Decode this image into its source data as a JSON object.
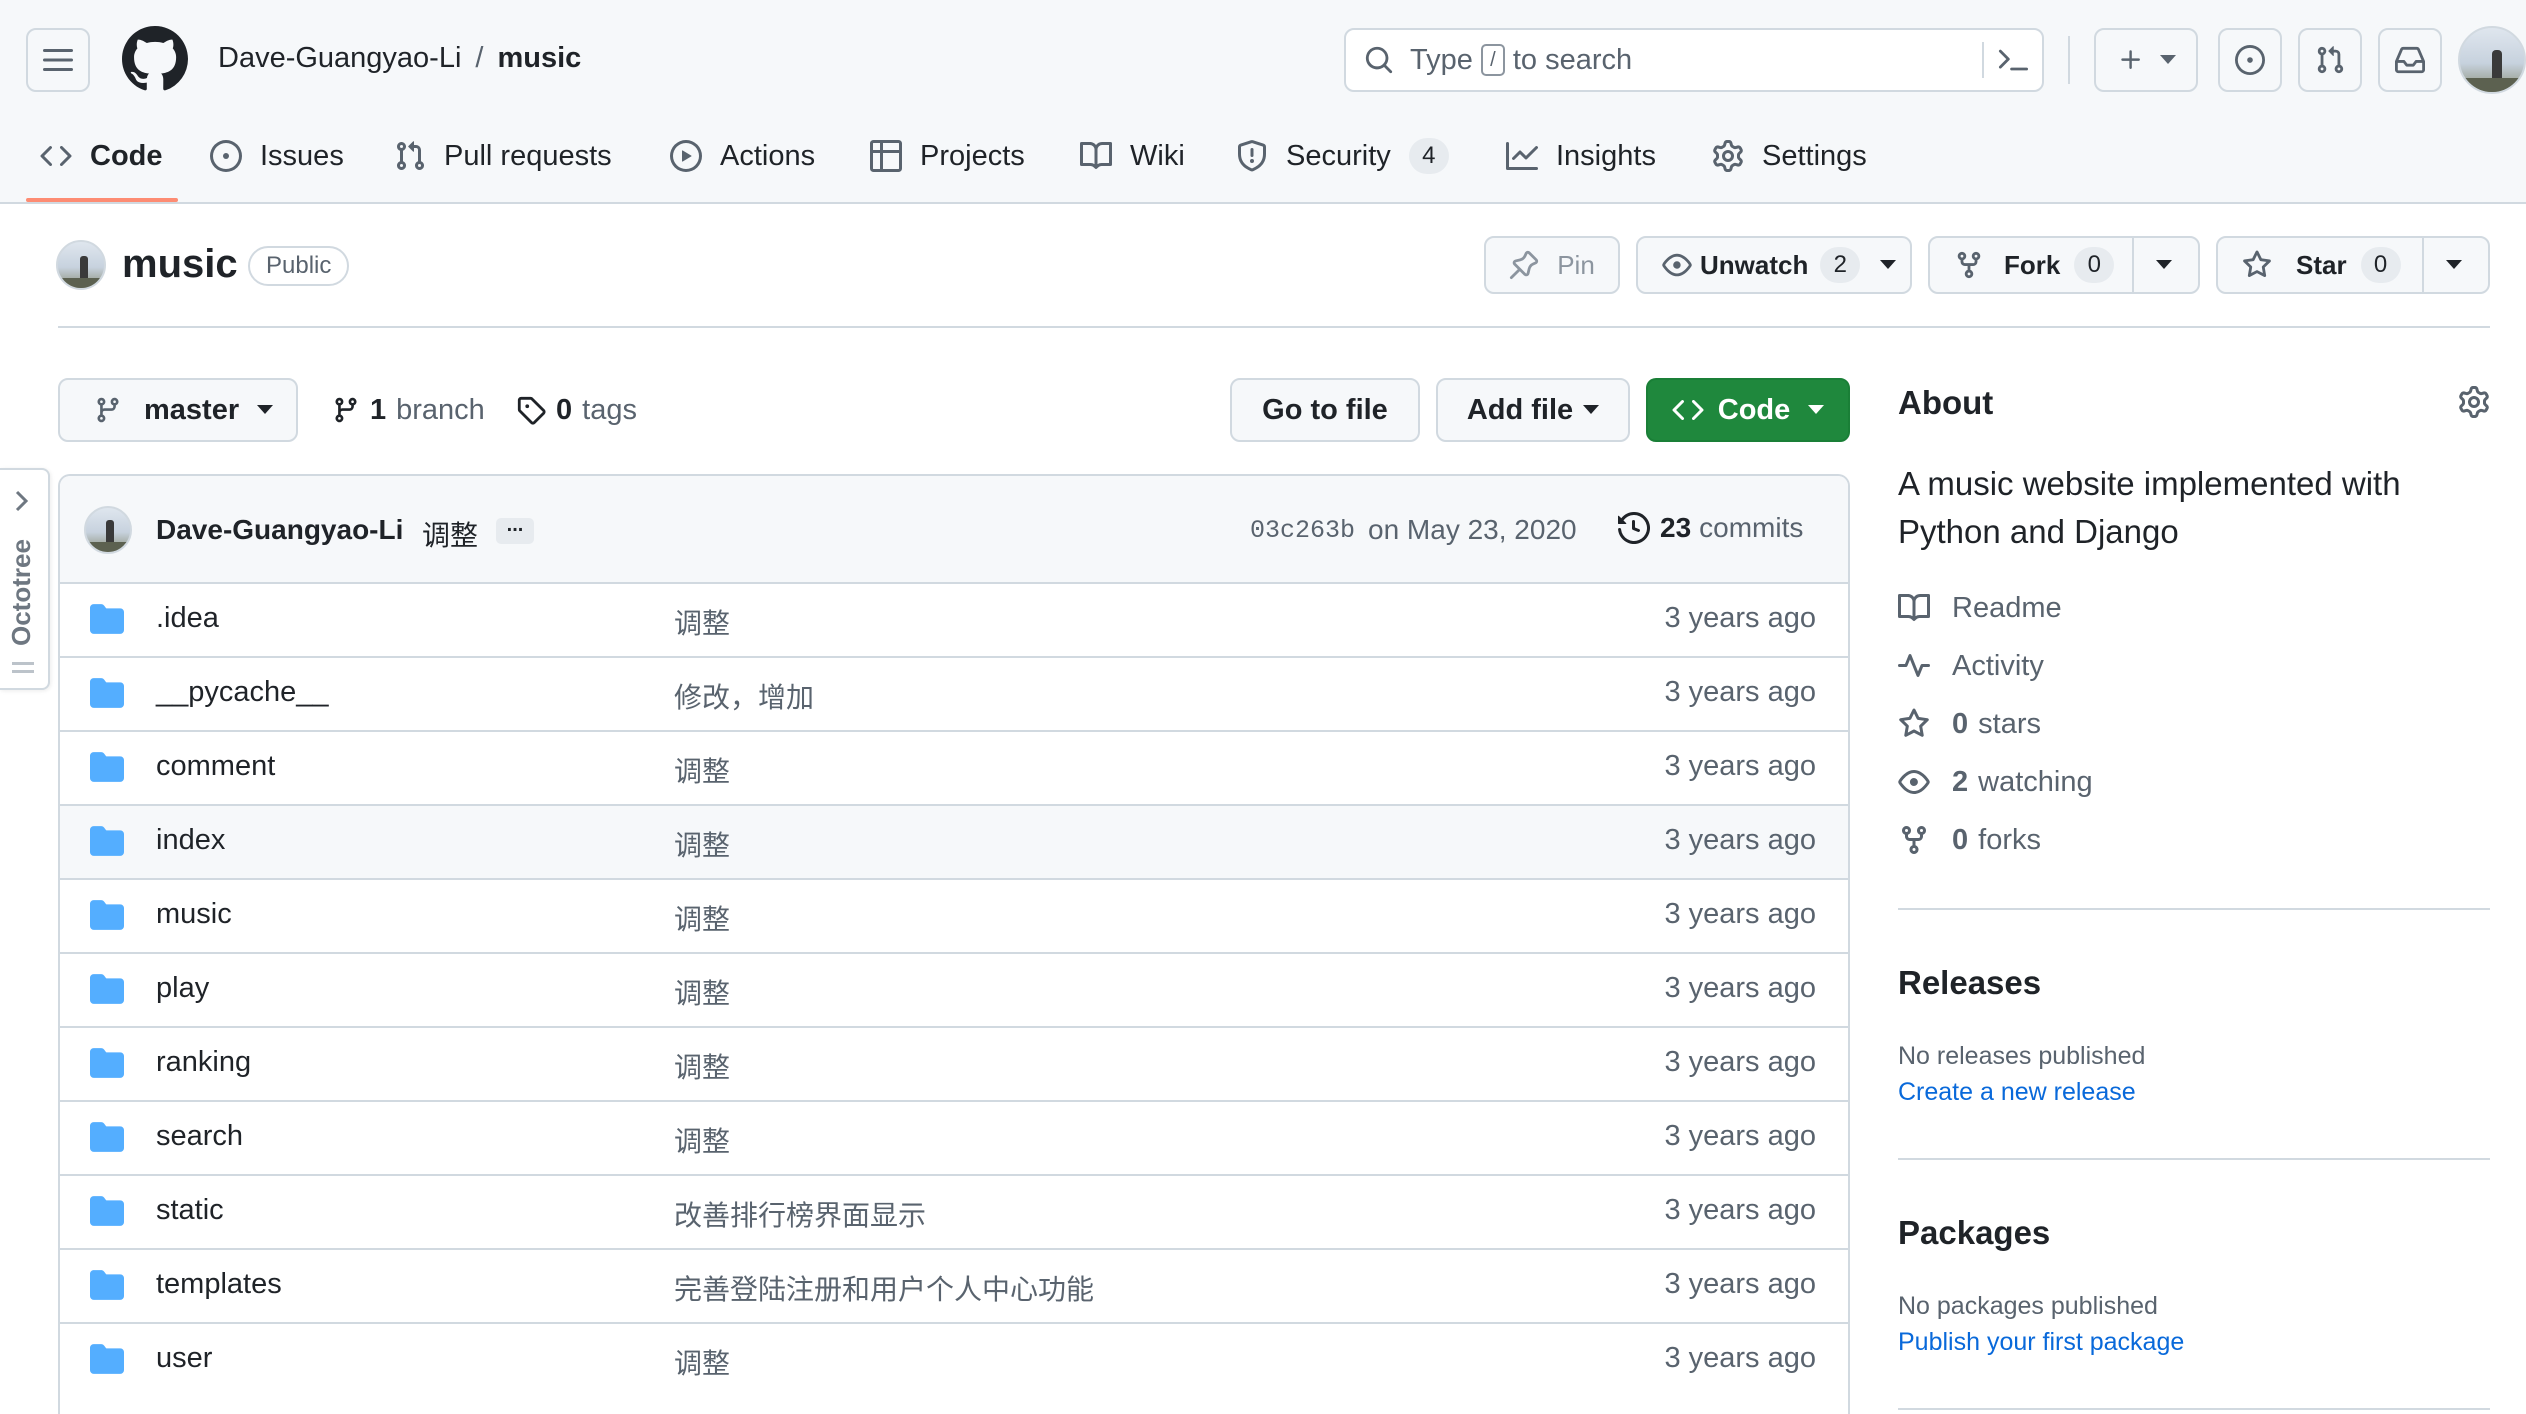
{
  "header": {
    "owner": "Dave-Guangyao-Li",
    "separator": "/",
    "repo": "music",
    "search_placeholder_before": "Type",
    "search_key": "/",
    "search_placeholder_after": "to search"
  },
  "tabs": [
    {
      "label": "Code",
      "icon": "code-icon",
      "active": true
    },
    {
      "label": "Issues",
      "icon": "issue-icon"
    },
    {
      "label": "Pull requests",
      "icon": "pull-request-icon"
    },
    {
      "label": "Actions",
      "icon": "play-icon"
    },
    {
      "label": "Projects",
      "icon": "table-icon"
    },
    {
      "label": "Wiki",
      "icon": "book-icon"
    },
    {
      "label": "Security",
      "icon": "shield-icon",
      "count": "4"
    },
    {
      "label": "Insights",
      "icon": "graph-icon"
    },
    {
      "label": "Settings",
      "icon": "gear-icon"
    }
  ],
  "repo_head": {
    "name": "music",
    "visibility": "Public",
    "pin": "Pin",
    "unwatch": "Unwatch",
    "unwatch_count": "2",
    "fork": "Fork",
    "fork_count": "0",
    "star": "Star",
    "star_count": "0"
  },
  "toolbar": {
    "branch": "master",
    "branch_count": "1",
    "branch_label": "branch",
    "tags_count": "0",
    "tags_label": "tags",
    "go_to_file": "Go to file",
    "add_file": "Add file",
    "code": "Code"
  },
  "commit": {
    "author": "Dave-Guangyao-Li",
    "message": "调整",
    "ellipsis": "...",
    "hash": "03c263b",
    "date": "on May 23, 2020",
    "count": "23",
    "count_label": "commits"
  },
  "files": [
    {
      "name": ".idea",
      "message": "调整",
      "age": "3 years ago"
    },
    {
      "name": "__pycache__",
      "message": "修改，增加",
      "age": "3 years ago"
    },
    {
      "name": "comment",
      "message": "调整",
      "age": "3 years ago"
    },
    {
      "name": "index",
      "message": "调整",
      "age": "3 years ago"
    },
    {
      "name": "music",
      "message": "调整",
      "age": "3 years ago"
    },
    {
      "name": "play",
      "message": "调整",
      "age": "3 years ago"
    },
    {
      "name": "ranking",
      "message": "调整",
      "age": "3 years ago"
    },
    {
      "name": "search",
      "message": "调整",
      "age": "3 years ago"
    },
    {
      "name": "static",
      "message": "改善排行榜界面显示",
      "age": "3 years ago"
    },
    {
      "name": "templates",
      "message": "完善登陆注册和用户个人中心功能",
      "age": "3 years ago"
    },
    {
      "name": "user",
      "message": "调整",
      "age": "3 years ago"
    }
  ],
  "about": {
    "title": "About",
    "description": "A music website implemented with Python and Django",
    "readme": "Readme",
    "activity": "Activity",
    "stars_count": "0",
    "stars_label": "stars",
    "watching_count": "2",
    "watching_label": "watching",
    "forks_count": "0",
    "forks_label": "forks"
  },
  "releases": {
    "title": "Releases",
    "empty": "No releases published",
    "link": "Create a new release"
  },
  "packages": {
    "title": "Packages",
    "empty": "No packages published",
    "link": "Publish your first package"
  },
  "octotree": {
    "label": "Octotree"
  },
  "colors": {
    "primary_button": "#1f883d",
    "link": "#0969da",
    "folder": "#54aeff",
    "tab_underline": "#fd8c73",
    "octotree_accent": "#e8590c"
  }
}
